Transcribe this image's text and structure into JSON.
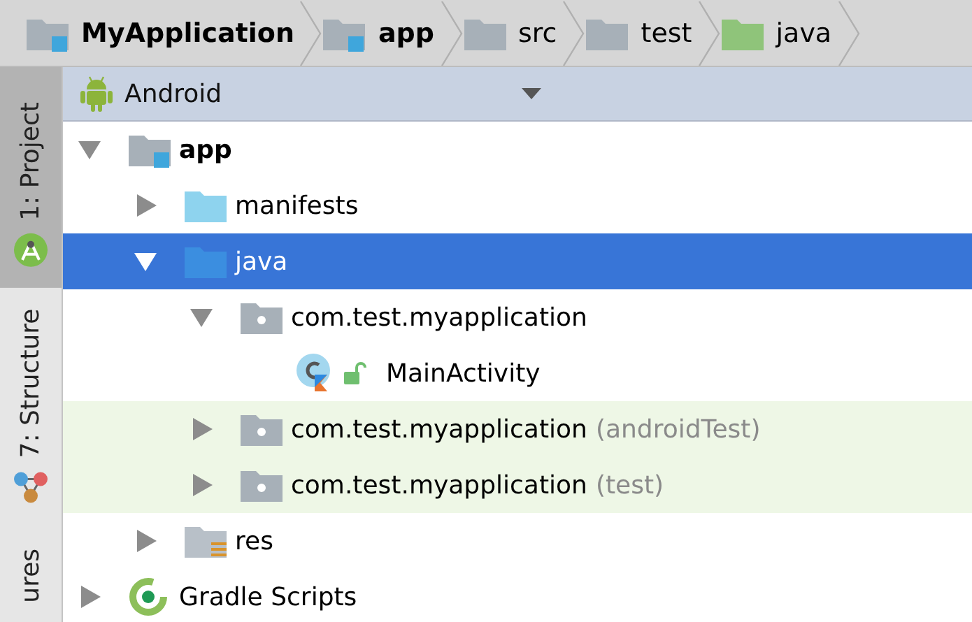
{
  "breadcrumbs": [
    {
      "label": "MyApplication",
      "kind": "module",
      "bold": true
    },
    {
      "label": "app",
      "kind": "module",
      "bold": true
    },
    {
      "label": "src",
      "kind": "plain_folder",
      "bold": false
    },
    {
      "label": "test",
      "kind": "plain_folder",
      "bold": false
    },
    {
      "label": "java",
      "kind": "test_folder",
      "bold": false
    }
  ],
  "side_tabs": [
    {
      "label": "1: Project",
      "kind": "project",
      "selected": true
    },
    {
      "label": "7: Structure",
      "kind": "structure",
      "selected": false
    },
    {
      "label": "ures",
      "kind": "none",
      "selected": false
    }
  ],
  "view_selector": {
    "label": "Android"
  },
  "tree": [
    {
      "label": "app",
      "kind": "module",
      "bold": true,
      "expanded": true,
      "selected": false,
      "highlighted": false,
      "children": [
        {
          "label": "manifests",
          "kind": "folder",
          "bold": false,
          "expanded": false,
          "selected": false,
          "highlighted": false
        },
        {
          "label": "java",
          "kind": "source_folder",
          "bold": false,
          "expanded": true,
          "selected": true,
          "highlighted": false,
          "children": [
            {
              "label": "com.test.myapplication",
              "kind": "package",
              "bold": false,
              "expanded": true,
              "selected": false,
              "highlighted": false,
              "children": [
                {
                  "label": "MainActivity",
                  "kind": "class",
                  "bold": false,
                  "selected": false,
                  "highlighted": false
                }
              ]
            },
            {
              "label": "com.test.myapplication",
              "qualifier": "(androidTest)",
              "kind": "package",
              "bold": false,
              "expanded": false,
              "selected": false,
              "highlighted": true
            },
            {
              "label": "com.test.myapplication",
              "qualifier": "(test)",
              "kind": "package",
              "bold": false,
              "expanded": false,
              "selected": false,
              "highlighted": true
            }
          ]
        },
        {
          "label": "res",
          "kind": "res_folder",
          "bold": false,
          "expanded": false,
          "selected": false,
          "highlighted": false
        }
      ]
    },
    {
      "label": "Gradle Scripts",
      "kind": "gradle",
      "bold": false,
      "expanded": false,
      "selected": false,
      "highlighted": false
    }
  ]
}
